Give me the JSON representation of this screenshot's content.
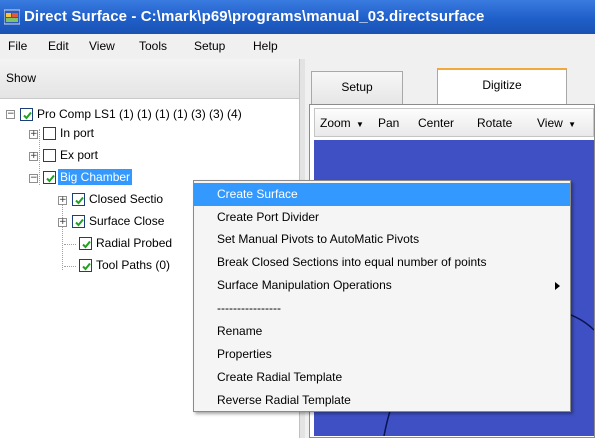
{
  "window": {
    "title": "Direct Surface - C:\\mark\\p69\\programs\\manual_03.directsurface",
    "icon": "app-icon"
  },
  "menubar": {
    "items": [
      "File",
      "Edit",
      "View",
      "Tools",
      "Setup",
      "Help"
    ]
  },
  "left_panel": {
    "header": "Show",
    "tree": [
      {
        "label": "Pro Comp LS1 (1) (1) (1) (1) (3) (3) (4)",
        "checked": true,
        "expanded": true
      },
      {
        "label": "In port",
        "checked": false,
        "expanded": false
      },
      {
        "label": "Ex port",
        "checked": false,
        "expanded": false
      },
      {
        "label": "Big Chamber",
        "checked": true,
        "expanded": true,
        "selected": true
      },
      {
        "label": "Closed Sectio",
        "checked": true,
        "expanded": false
      },
      {
        "label": "Surface Close",
        "checked": true,
        "expanded": false
      },
      {
        "label": "Radial Probed",
        "checked": true
      },
      {
        "label": "Tool Paths (0)",
        "checked": true
      }
    ]
  },
  "right_panel": {
    "tabs": [
      "Setup",
      "Digitize"
    ],
    "active_tab": "Digitize",
    "toolbar": {
      "zoom": "Zoom",
      "pan": "Pan",
      "center": "Center",
      "rotate": "Rotate",
      "view": "View"
    },
    "viewport_color": "#3f50c4"
  },
  "context_menu": {
    "items": [
      "Create Surface",
      "Create Port Divider",
      "Set Manual Pivots to AutoMatic Pivots",
      "Break Closed Sections into equal number of points",
      "Surface Manipulation Operations",
      "----------------",
      "Rename",
      "Properties",
      "Create Radial Template",
      "Reverse Radial Template"
    ],
    "highlighted": "Create Surface",
    "highlight_color": "#3399ff"
  }
}
